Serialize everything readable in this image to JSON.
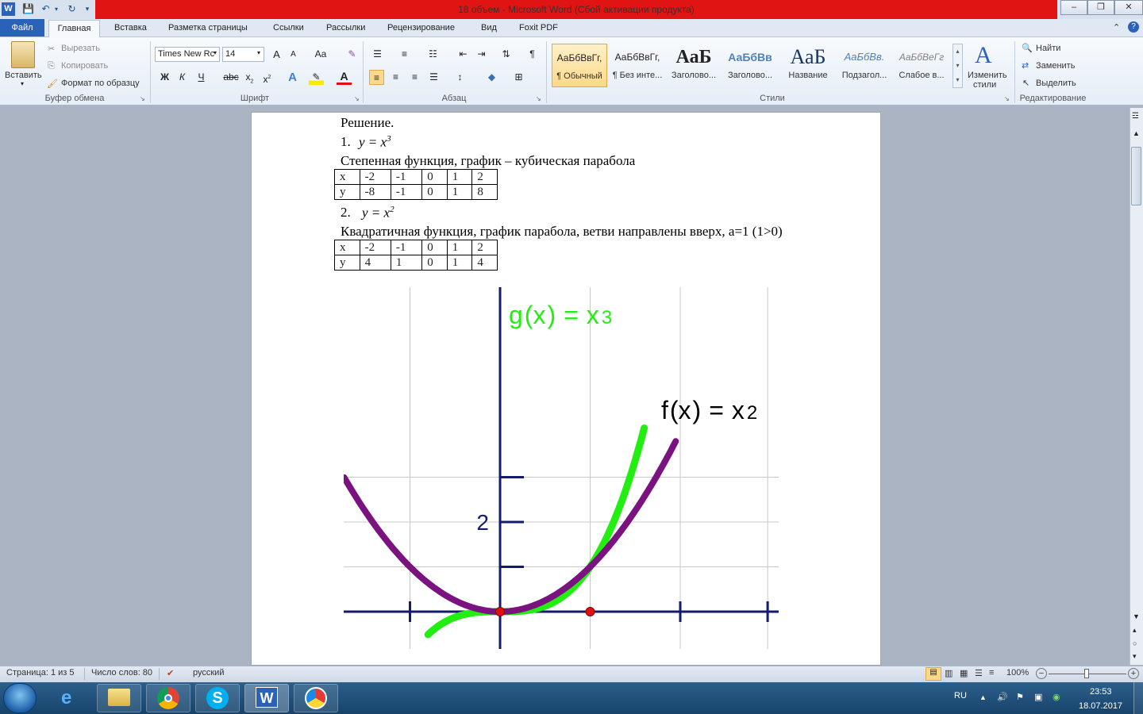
{
  "window": {
    "title": "18 объем  -  Microsoft Word (Сбой активации продукта)",
    "app_icon": "W"
  },
  "tabs": [
    {
      "label": "Файл"
    },
    {
      "label": "Главная"
    },
    {
      "label": "Вставка"
    },
    {
      "label": "Разметка страницы"
    },
    {
      "label": "Ссылки"
    },
    {
      "label": "Рассылки"
    },
    {
      "label": "Рецензирование"
    },
    {
      "label": "Вид"
    },
    {
      "label": "Foxit PDF"
    }
  ],
  "ribbon": {
    "clipboard": {
      "paste_label": "Вставить",
      "cut_label": "Вырезать",
      "copy_label": "Копировать",
      "format_label": "Формат по образцу",
      "group_label": "Буфер обмена"
    },
    "font": {
      "family": "Times New Rc",
      "size": "14",
      "grow": "A",
      "shrink": "A",
      "case": "Aa",
      "bold": "Ж",
      "italic": "К",
      "underline": "Ч",
      "strike": "abc",
      "sub": "x",
      "sup": "x",
      "group_label": "Шрифт"
    },
    "paragraph": {
      "group_label": "Абзац"
    },
    "styles": {
      "items": [
        {
          "preview": "АаБбВвГг,",
          "label": "¶ Обычный"
        },
        {
          "preview": "АаБбВвГг,",
          "label": "¶ Без инте..."
        },
        {
          "preview": "АаБ",
          "label": "Заголово..."
        },
        {
          "preview": "АаБбВв",
          "label": "Заголово..."
        },
        {
          "preview": "АаБ",
          "label": "Название"
        },
        {
          "preview": "АаБбВв.",
          "label": "Подзагол..."
        },
        {
          "preview": "АаБбВеГг",
          "label": "Слабое в..."
        }
      ],
      "change_label_1": "Изменить",
      "change_label_2": "стили",
      "group_label": "Стили"
    },
    "editing": {
      "find_label": "Найти",
      "replace_label": "Заменить",
      "select_label": "Выделить",
      "group_label": "Редактирование"
    }
  },
  "document": {
    "heading": "Решение.",
    "item1_num": "1.",
    "item1_formula_base": "y = x",
    "item1_formula_exp": "3",
    "item1_desc": "Степенная функция, график – кубическая парабола",
    "table1": {
      "rows": [
        [
          "x",
          "-2",
          "-1",
          "0",
          "1",
          "2"
        ],
        [
          "y",
          "-8",
          "-1",
          "0",
          "1",
          "8"
        ]
      ]
    },
    "item2_num": "2.",
    "item2_formula_base": "y = x",
    "item2_formula_exp": "2",
    "item2_desc": "Квадратичная функция, график парабола, ветви направлены вверх, а=1 (1>0)",
    "table2": {
      "rows": [
        [
          "x",
          "-2",
          "-1",
          "0",
          "1",
          "2"
        ],
        [
          "y",
          "4",
          "1",
          "0",
          "1",
          "4"
        ]
      ]
    }
  },
  "chart_data": {
    "type": "line",
    "series": [
      {
        "name": "g(x) = x3",
        "color": "#22ee11",
        "function": "x^3"
      },
      {
        "name": "f(x) = x2",
        "color": "#7a1380",
        "function": "x^2"
      }
    ],
    "label_g": {
      "name": "g",
      "lp": "(",
      "var": "x",
      "rp": ")",
      "eq": "=",
      "base": "x",
      "exp": "3"
    },
    "label_f": {
      "name": "f",
      "lp": "(",
      "var": "x",
      "rp": ")",
      "eq": "=",
      "base": "x",
      "exp": "2"
    },
    "y_tick_label": "2",
    "points": [
      [
        0,
        0
      ],
      [
        1,
        0
      ]
    ],
    "xlim": [
      -1.75,
      3
    ],
    "ylim": [
      -0.4,
      3.65
    ],
    "grid": true,
    "colors": {
      "axis": "#141b6e",
      "grid": "#c8c8c8",
      "point": "#e01010"
    }
  },
  "status": {
    "page": "Страница: 1 из 5",
    "words": "Число слов: 80",
    "language": "русский",
    "zoom": "100%",
    "zoom_minus": "−",
    "zoom_plus": "+"
  },
  "taskbar": {
    "lang": "RU",
    "time": "23:53",
    "date": "18.07.2017"
  }
}
